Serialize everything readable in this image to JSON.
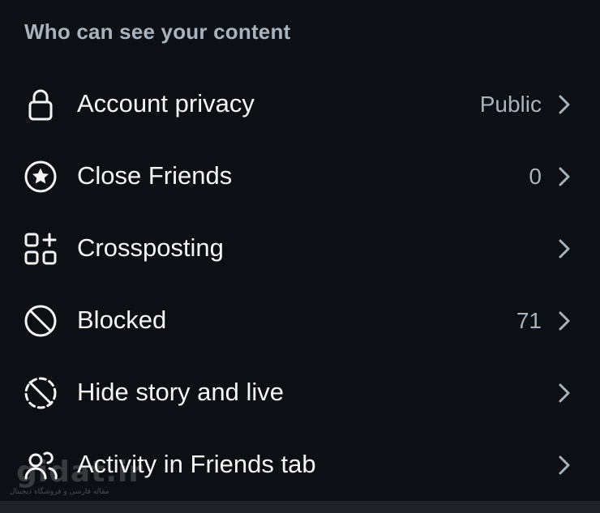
{
  "section": {
    "title": "Who can see your content"
  },
  "items": [
    {
      "label": "Account privacy",
      "value": "Public",
      "icon": "lock-icon"
    },
    {
      "label": "Close Friends",
      "value": "0",
      "icon": "star-circle-icon"
    },
    {
      "label": "Crossposting",
      "value": "",
      "icon": "grid-plus-icon"
    },
    {
      "label": "Blocked",
      "value": "71",
      "icon": "blocked-icon"
    },
    {
      "label": "Hide story and live",
      "value": "",
      "icon": "hide-story-icon"
    },
    {
      "label": "Activity in Friends tab",
      "value": "",
      "icon": "friends-activity-icon"
    }
  ],
  "watermark": {
    "brand": "gidat.ir",
    "sub": "مقاله فارسی و فروشگاه دیجیتال"
  },
  "colors": {
    "background": "#0c1014",
    "text_primary": "#f5f5f5",
    "text_secondary": "#a8b3bd"
  }
}
